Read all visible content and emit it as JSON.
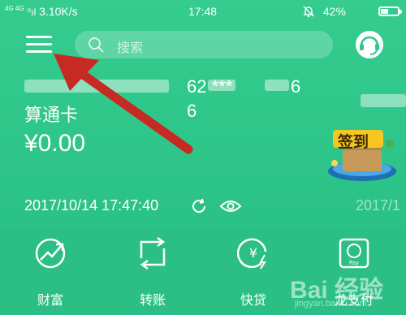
{
  "status_bar": {
    "network": "4G 4G",
    "signal": "⁰ıl",
    "speed": "3.10K/s",
    "time": "17:48",
    "alarm_icon": "bell-off-icon",
    "battery": "42%",
    "battery_level": 0.42
  },
  "header": {
    "menu_icon": "hamburger-menu-icon",
    "search_placeholder": "搜索",
    "service_icon": "customer-service-headset-icon"
  },
  "account": {
    "number": "62 ***",
    "number_tail": "6",
    "card_name": "算通卡",
    "card_suffix": "6",
    "balance": "¥0.00"
  },
  "checkin": {
    "label": "签到"
  },
  "info_row": {
    "timestamp": "2017/10/14 17:47:40",
    "timestamp_next": "2017/1"
  },
  "quick_actions": [
    {
      "label": "财富",
      "icon": "wealth-chart-icon"
    },
    {
      "label": "转账",
      "icon": "transfer-arrows-icon"
    },
    {
      "label": "快贷",
      "icon": "quick-loan-yen-icon"
    },
    {
      "label": "龙支付",
      "icon": "dragon-pay-icon"
    }
  ],
  "colors": {
    "background": "#2fc78a",
    "arrow": "#c62a22"
  },
  "watermark": {
    "logo": "Bai 经验",
    "url": "jingyan.baidu.com"
  }
}
